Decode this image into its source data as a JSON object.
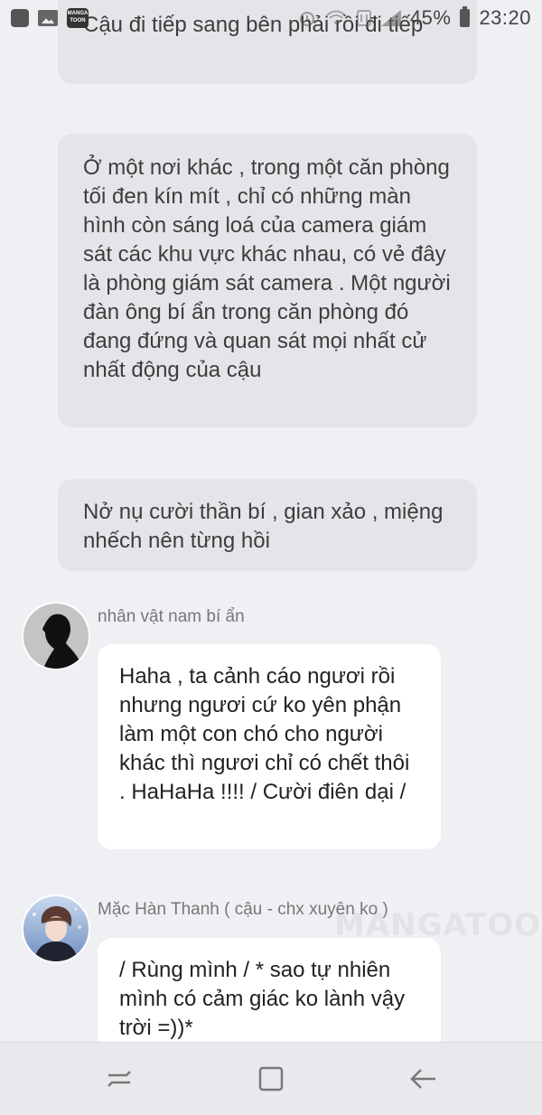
{
  "status_bar": {
    "battery_percent": "45%",
    "time": "23:20",
    "app_icon_text": "MANGA TOON",
    "icons": [
      "app-square-icon",
      "gallery-icon",
      "mangatoon-app-icon",
      "alarm-icon",
      "wifi-icon",
      "data-transfer-icon",
      "cell-signal-icon",
      "battery-icon"
    ]
  },
  "narrations": [
    {
      "text": "Cậu đi tiếp sang bên phải rồi đi tiếp"
    },
    {
      "text": "Ở một nơi khác , trong một căn phòng tối đen kín mít , chỉ có những màn hình còn sáng loá của camera giám sát các khu vực khác nhau, có vẻ đây là phòng giám sát camera . Một người đàn ông bí ẩn trong căn phòng đó đang đứng và quan sát mọi nhất cử nhất động của cậu"
    },
    {
      "text": "Nở nụ cười thần bí , gian xảo , miệng nhếch nên từng hồi"
    }
  ],
  "messages": [
    {
      "speaker": "nhân vật nam bí ẩn",
      "text": "Haha , ta cảnh cáo ngươi rồi nhưng ngươi cứ ko yên phận làm một con chó cho người khác thì ngươi chỉ có chết thôi . HaHaHa !!!! / Cười điên dại /"
    },
    {
      "speaker": "Mặc Hàn Thanh ( cậu - chx xuyên ko )",
      "text": "/ Rùng mình / * sao tự nhiên mình có cảm giác ko lành vậy trời =))*"
    }
  ],
  "watermark": "MANGATOON",
  "nav_bar": {
    "buttons": [
      "recent-apps-icon",
      "home-icon",
      "back-icon"
    ]
  },
  "colors": {
    "background": "#eef0f3",
    "narration_bubble": "#e4e5e8",
    "dialogue_bubble": "#ffffff",
    "nav_bar": "#e8e9ec"
  }
}
